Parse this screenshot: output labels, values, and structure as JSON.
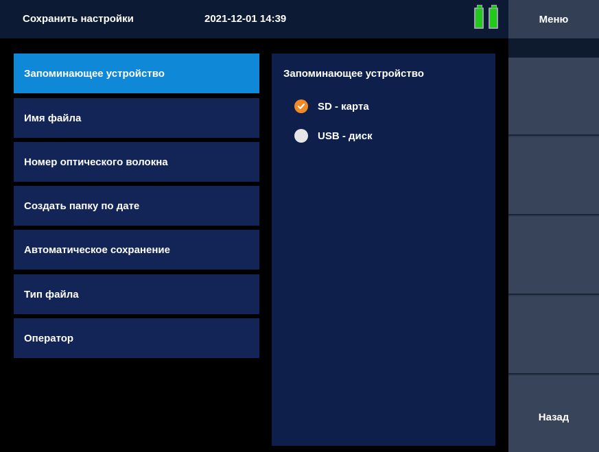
{
  "header": {
    "title": "Сохранить настройки",
    "datetime": "2021-12-01 14:39",
    "battery_color": "#22c91a"
  },
  "softkeys": {
    "menu_label": "Меню",
    "keys": [
      "",
      "",
      "",
      "",
      "Назад"
    ]
  },
  "menu": {
    "items": [
      {
        "label": "Запоминающее устройство",
        "selected": true
      },
      {
        "label": "Имя файла",
        "selected": false
      },
      {
        "label": "Номер оптического волокна",
        "selected": false
      },
      {
        "label": "Создать папку по дате",
        "selected": false
      },
      {
        "label": "Автоматическое сохранение",
        "selected": false
      },
      {
        "label": "Тип файла",
        "selected": false
      },
      {
        "label": "Оператор",
        "selected": false
      }
    ],
    "selected_color": "#0f88d8",
    "item_color": "#132457"
  },
  "detail": {
    "title": "Запоминающее устройство",
    "options": [
      {
        "label": "SD - карта",
        "checked": true,
        "icon": "radio-checked-icon"
      },
      {
        "label": "USB - диск",
        "checked": false,
        "icon": "radio-unchecked-icon"
      }
    ],
    "checked_color": "#f08a24"
  }
}
